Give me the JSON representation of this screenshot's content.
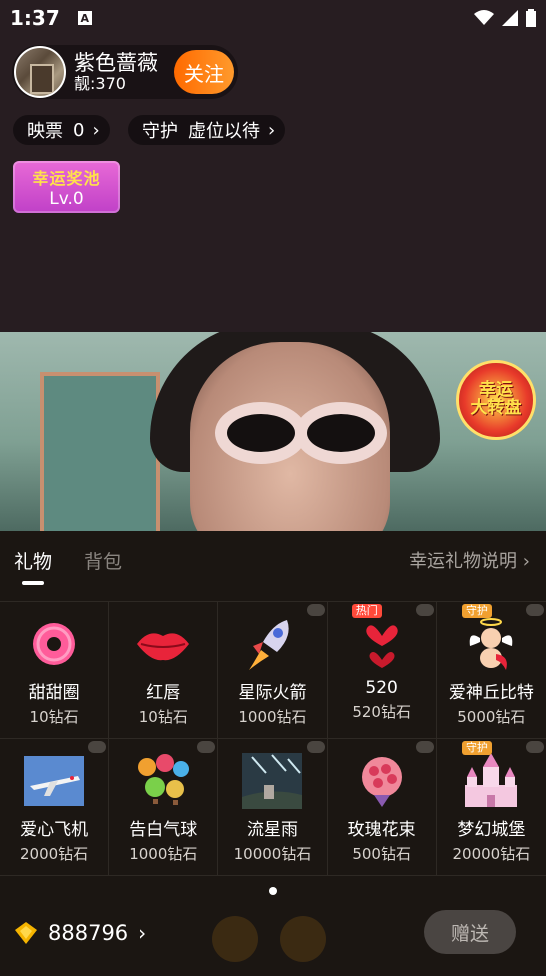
{
  "status_bar": {
    "time": "1:37",
    "a_badge": "A"
  },
  "anchor": {
    "name": "紫色蔷薇",
    "score": "靓:370",
    "follow_label": "关注"
  },
  "tickets": {
    "label": "映票",
    "value": "0"
  },
  "guard": {
    "label": "守护",
    "value": "虚位以待"
  },
  "lucky_pool": {
    "title": "幸运奖池",
    "level": "Lv.0"
  },
  "wheel": {
    "line1": "幸运",
    "line2": "大转盘"
  },
  "panel": {
    "tab_gifts": "礼物",
    "tab_bag": "背包",
    "help_link": "幸运礼物说明"
  },
  "gifts": [
    {
      "name": "甜甜圈",
      "price": "10钻石",
      "icon": "donut-icon"
    },
    {
      "name": "红唇",
      "price": "10钻石",
      "icon": "lips-icon"
    },
    {
      "name": "星际火箭",
      "price": "1000钻石",
      "icon": "rocket-icon"
    },
    {
      "name": "520",
      "price": "520钻石",
      "icon": "hearts-balloon-icon",
      "badge": "热门"
    },
    {
      "name": "爱神丘比特",
      "price": "5000钻石",
      "icon": "cupid-icon",
      "badge": "守护"
    },
    {
      "name": "爱心飞机",
      "price": "2000钻石",
      "icon": "airplane-icon"
    },
    {
      "name": "告白气球",
      "price": "1000钻石",
      "icon": "hot-air-balloon-icon"
    },
    {
      "name": "流星雨",
      "price": "10000钻石",
      "icon": "meteor-shower-icon"
    },
    {
      "name": "玫瑰花束",
      "price": "500钻石",
      "icon": "rose-bouquet-icon"
    },
    {
      "name": "梦幻城堡",
      "price": "20000钻石",
      "icon": "castle-icon",
      "badge": "守护"
    }
  ],
  "balance": {
    "amount": "888796"
  },
  "send_label": "赠送",
  "colors": {
    "follow": "#ff7a14",
    "hot": "#ff4a3a",
    "guard": "#f0a030"
  }
}
